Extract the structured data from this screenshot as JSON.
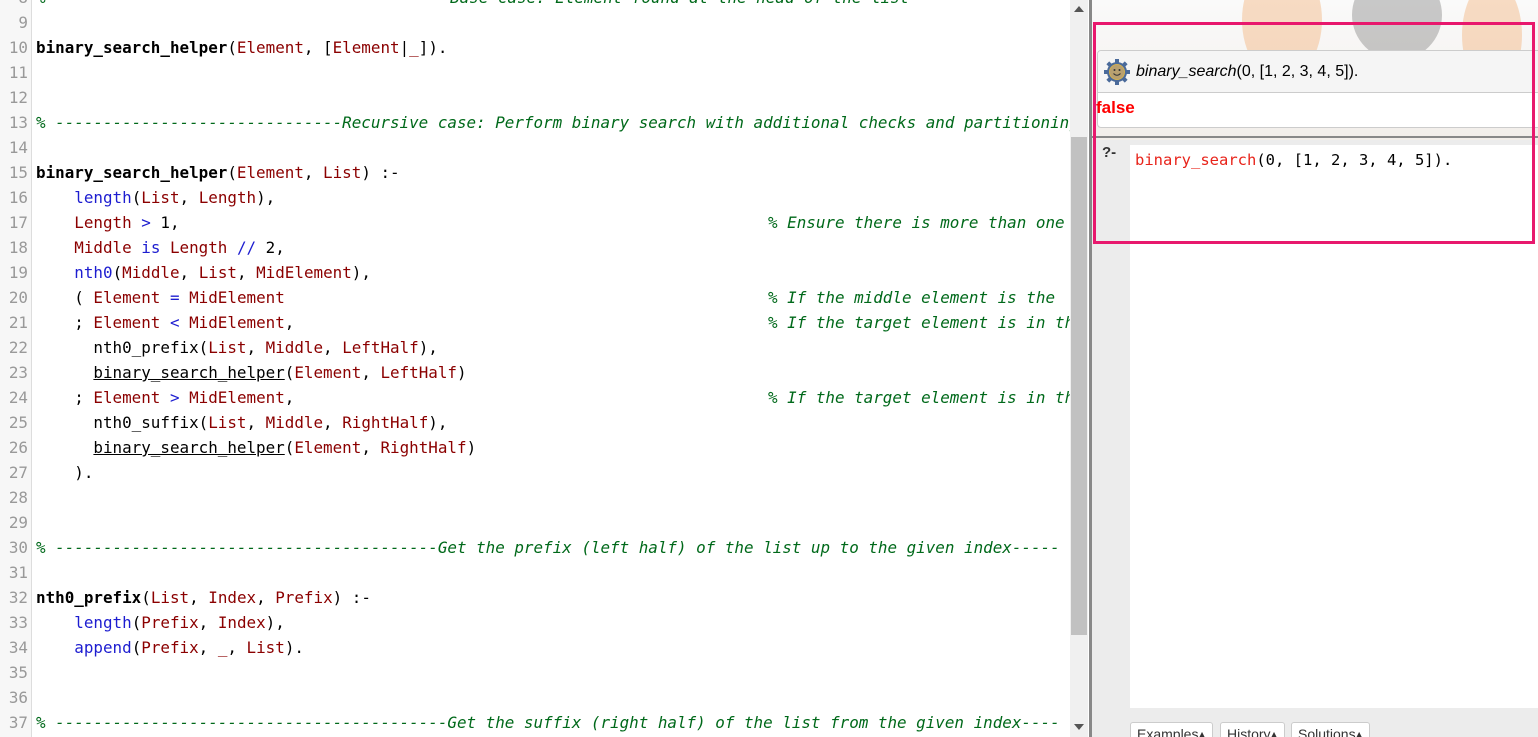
{
  "editor": {
    "lines": [
      {
        "n": "8",
        "tokens": [
          [
            "c",
            "%"
          ]
        ],
        "tail": "Base case: Element found at the head of the list",
        "tail_left": true
      },
      {
        "n": "9",
        "tokens": []
      },
      {
        "n": "10",
        "tokens": [
          [
            "h",
            "binary_search_helper"
          ],
          [
            "p",
            "("
          ],
          [
            "v",
            "Element"
          ],
          [
            "p",
            ", ["
          ],
          [
            "v",
            "Element"
          ],
          [
            "p",
            "|"
          ],
          [
            "v",
            "_"
          ],
          [
            "p",
            "])."
          ]
        ]
      },
      {
        "n": "11",
        "tokens": []
      },
      {
        "n": "12",
        "tokens": []
      },
      {
        "n": "13",
        "tokens": [
          [
            "c",
            "% ------------------------------Recursive case: Perform binary search with additional checks and partitioning"
          ]
        ]
      },
      {
        "n": "14",
        "tokens": []
      },
      {
        "n": "15",
        "tokens": [
          [
            "h",
            "binary_search_helper"
          ],
          [
            "p",
            "("
          ],
          [
            "v",
            "Element"
          ],
          [
            "p",
            ", "
          ],
          [
            "v",
            "List"
          ],
          [
            "p",
            ") :-"
          ]
        ]
      },
      {
        "n": "16",
        "tokens": [
          [
            "p",
            "    "
          ],
          [
            "b",
            "length"
          ],
          [
            "p",
            "("
          ],
          [
            "v",
            "List"
          ],
          [
            "p",
            ", "
          ],
          [
            "v",
            "Length"
          ],
          [
            "p",
            "),"
          ]
        ]
      },
      {
        "n": "17",
        "tokens": [
          [
            "p",
            "    "
          ],
          [
            "v",
            "Length"
          ],
          [
            "o",
            " >"
          ],
          [
            "p",
            " 1,"
          ]
        ],
        "tail": "% Ensure there is more than one"
      },
      {
        "n": "18",
        "tokens": [
          [
            "p",
            "    "
          ],
          [
            "v",
            "Middle"
          ],
          [
            "o",
            " is "
          ],
          [
            "v",
            "Length"
          ],
          [
            "o",
            " //"
          ],
          [
            "p",
            " 2,"
          ]
        ]
      },
      {
        "n": "19",
        "tokens": [
          [
            "p",
            "    "
          ],
          [
            "b",
            "nth0"
          ],
          [
            "p",
            "("
          ],
          [
            "v",
            "Middle"
          ],
          [
            "p",
            ", "
          ],
          [
            "v",
            "List"
          ],
          [
            "p",
            ", "
          ],
          [
            "v",
            "MidElement"
          ],
          [
            "p",
            "),"
          ]
        ]
      },
      {
        "n": "20",
        "tokens": [
          [
            "p",
            "    ( "
          ],
          [
            "v",
            "Element"
          ],
          [
            "o",
            " ="
          ],
          [
            "p",
            " "
          ],
          [
            "v",
            "MidElement"
          ]
        ],
        "tail": "% If the middle element is the"
      },
      {
        "n": "21",
        "tokens": [
          [
            "p",
            "    ; "
          ],
          [
            "v",
            "Element"
          ],
          [
            "o",
            " <"
          ],
          [
            "p",
            " "
          ],
          [
            "v",
            "MidElement"
          ],
          [
            "p",
            ","
          ]
        ],
        "tail": "% If the target element is in th"
      },
      {
        "n": "22",
        "tokens": [
          [
            "p",
            "      nth0_prefix("
          ],
          [
            "v",
            "List"
          ],
          [
            "p",
            ", "
          ],
          [
            "v",
            "Middle"
          ],
          [
            "p",
            ", "
          ],
          [
            "v",
            "LeftHalf"
          ],
          [
            "p",
            "),"
          ]
        ]
      },
      {
        "n": "23",
        "tokens": [
          [
            "p",
            "      "
          ],
          [
            "u",
            "binary_search_helper"
          ],
          [
            "p",
            "("
          ],
          [
            "v",
            "Element"
          ],
          [
            "p",
            ", "
          ],
          [
            "v",
            "LeftHalf"
          ],
          [
            "p",
            ")"
          ]
        ]
      },
      {
        "n": "24",
        "tokens": [
          [
            "p",
            "    ; "
          ],
          [
            "v",
            "Element"
          ],
          [
            "o",
            " >"
          ],
          [
            "p",
            " "
          ],
          [
            "v",
            "MidElement"
          ],
          [
            "p",
            ","
          ]
        ],
        "tail": "% If the target element is in th"
      },
      {
        "n": "25",
        "tokens": [
          [
            "p",
            "      nth0_suffix("
          ],
          [
            "v",
            "List"
          ],
          [
            "p",
            ", "
          ],
          [
            "v",
            "Middle"
          ],
          [
            "p",
            ", "
          ],
          [
            "v",
            "RightHalf"
          ],
          [
            "p",
            "),"
          ]
        ]
      },
      {
        "n": "26",
        "tokens": [
          [
            "p",
            "      "
          ],
          [
            "u",
            "binary_search_helper"
          ],
          [
            "p",
            "("
          ],
          [
            "v",
            "Element"
          ],
          [
            "p",
            ", "
          ],
          [
            "v",
            "RightHalf"
          ],
          [
            "p",
            ")"
          ]
        ]
      },
      {
        "n": "27",
        "tokens": [
          [
            "p",
            "    )."
          ]
        ]
      },
      {
        "n": "28",
        "tokens": []
      },
      {
        "n": "29",
        "tokens": []
      },
      {
        "n": "30",
        "tokens": [
          [
            "c",
            "% ----------------------------------------Get the prefix (left half) of the list up to the given index-----"
          ]
        ]
      },
      {
        "n": "31",
        "tokens": []
      },
      {
        "n": "32",
        "tokens": [
          [
            "h",
            "nth0_prefix"
          ],
          [
            "p",
            "("
          ],
          [
            "v",
            "List"
          ],
          [
            "p",
            ", "
          ],
          [
            "v",
            "Index"
          ],
          [
            "p",
            ", "
          ],
          [
            "v",
            "Prefix"
          ],
          [
            "p",
            ") :-"
          ]
        ]
      },
      {
        "n": "33",
        "tokens": [
          [
            "p",
            "    "
          ],
          [
            "b",
            "length"
          ],
          [
            "p",
            "("
          ],
          [
            "v",
            "Prefix"
          ],
          [
            "p",
            ", "
          ],
          [
            "v",
            "Index"
          ],
          [
            "p",
            "),"
          ]
        ]
      },
      {
        "n": "34",
        "tokens": [
          [
            "p",
            "    "
          ],
          [
            "b",
            "append"
          ],
          [
            "p",
            "("
          ],
          [
            "v",
            "Prefix"
          ],
          [
            "p",
            ", "
          ],
          [
            "v",
            "_"
          ],
          [
            "p",
            ", "
          ],
          [
            "v",
            "List"
          ],
          [
            "p",
            ")."
          ]
        ]
      },
      {
        "n": "35",
        "tokens": []
      },
      {
        "n": "36",
        "tokens": []
      },
      {
        "n": "37",
        "tokens": [
          [
            "c",
            "% -----------------------------------------Get the suffix (right half) of the list from the given index----"
          ]
        ]
      }
    ]
  },
  "query_panel": {
    "icon": "gear-smiley-icon",
    "query_pred": "binary_search",
    "query_args": "(0, [1, 2, 3, 4, 5]).",
    "result": "false",
    "result_color": "#ff0000"
  },
  "query_input": {
    "prompt": "?-",
    "pred": "binary_search",
    "args": "(0, [1, 2, 3, 4, 5])."
  },
  "bottom_tabs": [
    {
      "label": "Examples▴"
    },
    {
      "label": "History▴"
    },
    {
      "label": "Solutions▴"
    }
  ],
  "highlight_color": "#e8186d"
}
